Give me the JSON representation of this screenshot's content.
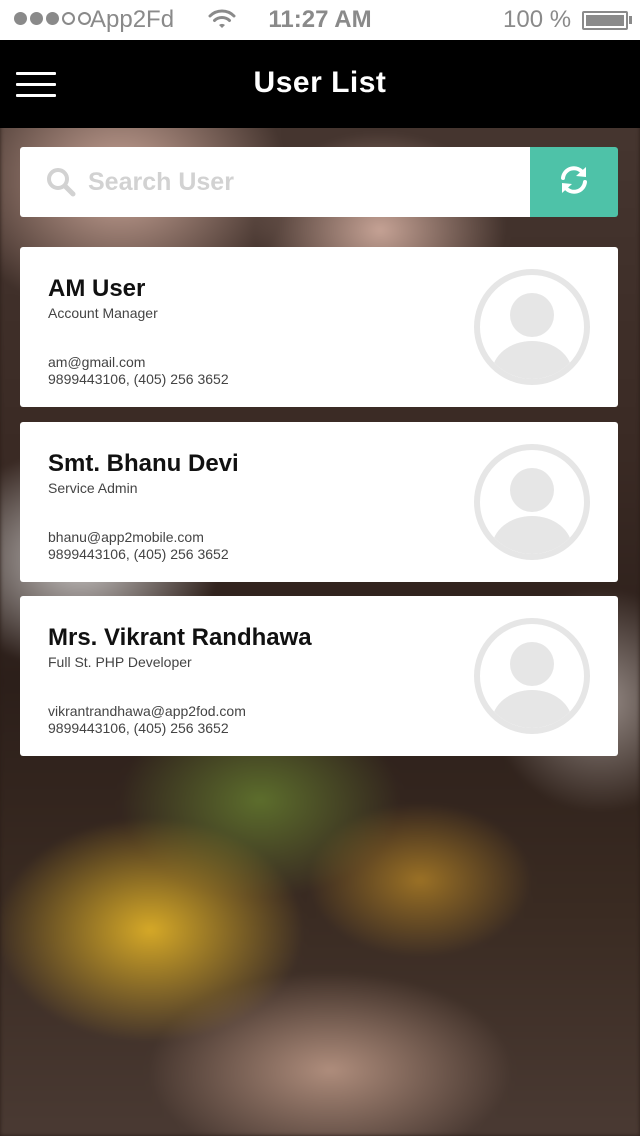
{
  "status_bar": {
    "carrier": "App2Fd",
    "time": "11:27 AM",
    "battery": "100 %",
    "signal_bars_filled": 3,
    "signal_bars_total": 5
  },
  "nav": {
    "title": "User List",
    "menu_icon": "hamburger-menu-icon"
  },
  "search": {
    "placeholder": "Search User",
    "value": "",
    "search_icon": "search-icon",
    "refresh_icon": "refresh-icon",
    "accent_color": "#4ec2a8"
  },
  "users": [
    {
      "name": "AM User",
      "role": "Account Manager",
      "email": "am@gmail.com",
      "phone": "9899443106, (405) 256 3652"
    },
    {
      "name": "Smt. Bhanu Devi",
      "role": "Service Admin",
      "email": "bhanu@app2mobile.com",
      "phone": "9899443106, (405) 256 3652"
    },
    {
      "name": "Mrs. Vikrant Randhawa",
      "role": "Full St. PHP Developer",
      "email": "vikrantrandhawa@app2fod.com",
      "phone": "9899443106, (405) 256 3652"
    }
  ]
}
